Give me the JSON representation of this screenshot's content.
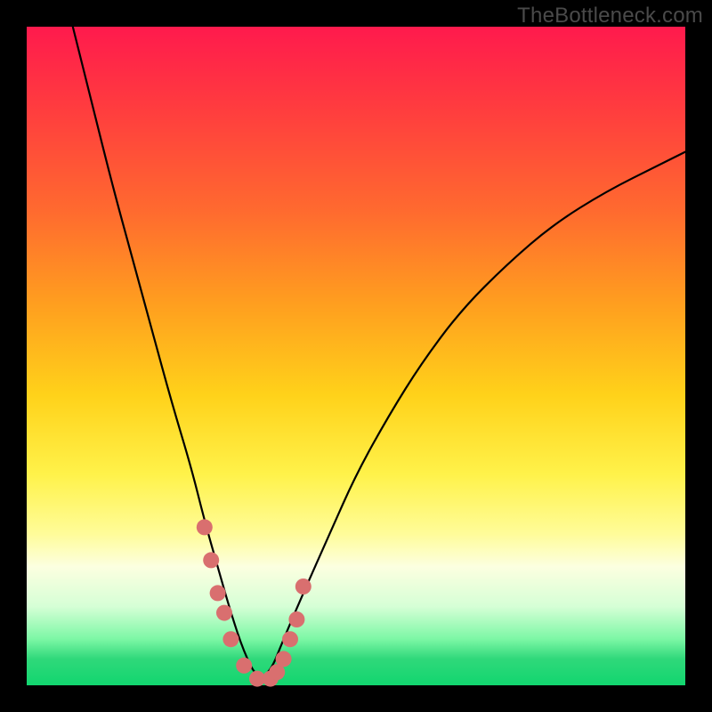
{
  "watermark": "TheBottleneck.com",
  "colors": {
    "frame": "#000000",
    "gradient_top": "#ff1a4d",
    "gradient_bottom": "#12d66f",
    "curve": "#000000",
    "marker": "#d96f6f"
  },
  "chart_data": {
    "type": "line",
    "title": "",
    "xlabel": "",
    "ylabel": "",
    "xlim": [
      0,
      100
    ],
    "ylim": [
      0,
      100
    ],
    "legend": null,
    "grid": false,
    "comment": "Bottleneck curve: y = |x - 35| scaled; minimum (optimal match) at x≈35. Left branch steep (CPU-bound), right branch shallower asymptotic (GPU-bound). Values estimated from pixel positions; no axis ticks are rendered.",
    "series": [
      {
        "name": "bottleneck-curve",
        "x": [
          7,
          10,
          13,
          16,
          19,
          22,
          25,
          27,
          29,
          31,
          33,
          35,
          37,
          39,
          42,
          46,
          50,
          55,
          60,
          66,
          73,
          80,
          88,
          96,
          100
        ],
        "y": [
          100,
          88,
          76,
          65,
          54,
          43,
          33,
          25,
          18,
          11,
          5,
          1,
          2,
          7,
          14,
          23,
          32,
          41,
          49,
          57,
          64,
          70,
          75,
          79,
          81
        ]
      }
    ],
    "markers": {
      "comment": "Sparse highlighted data points clustered near the curve minimum",
      "points": [
        {
          "x": 27,
          "y": 24
        },
        {
          "x": 28,
          "y": 19
        },
        {
          "x": 29,
          "y": 14
        },
        {
          "x": 30,
          "y": 11
        },
        {
          "x": 31,
          "y": 7
        },
        {
          "x": 33,
          "y": 3
        },
        {
          "x": 35,
          "y": 1
        },
        {
          "x": 37,
          "y": 1
        },
        {
          "x": 38,
          "y": 2
        },
        {
          "x": 39,
          "y": 4
        },
        {
          "x": 40,
          "y": 7
        },
        {
          "x": 41,
          "y": 10
        },
        {
          "x": 42,
          "y": 15
        }
      ],
      "radius": 9
    }
  }
}
